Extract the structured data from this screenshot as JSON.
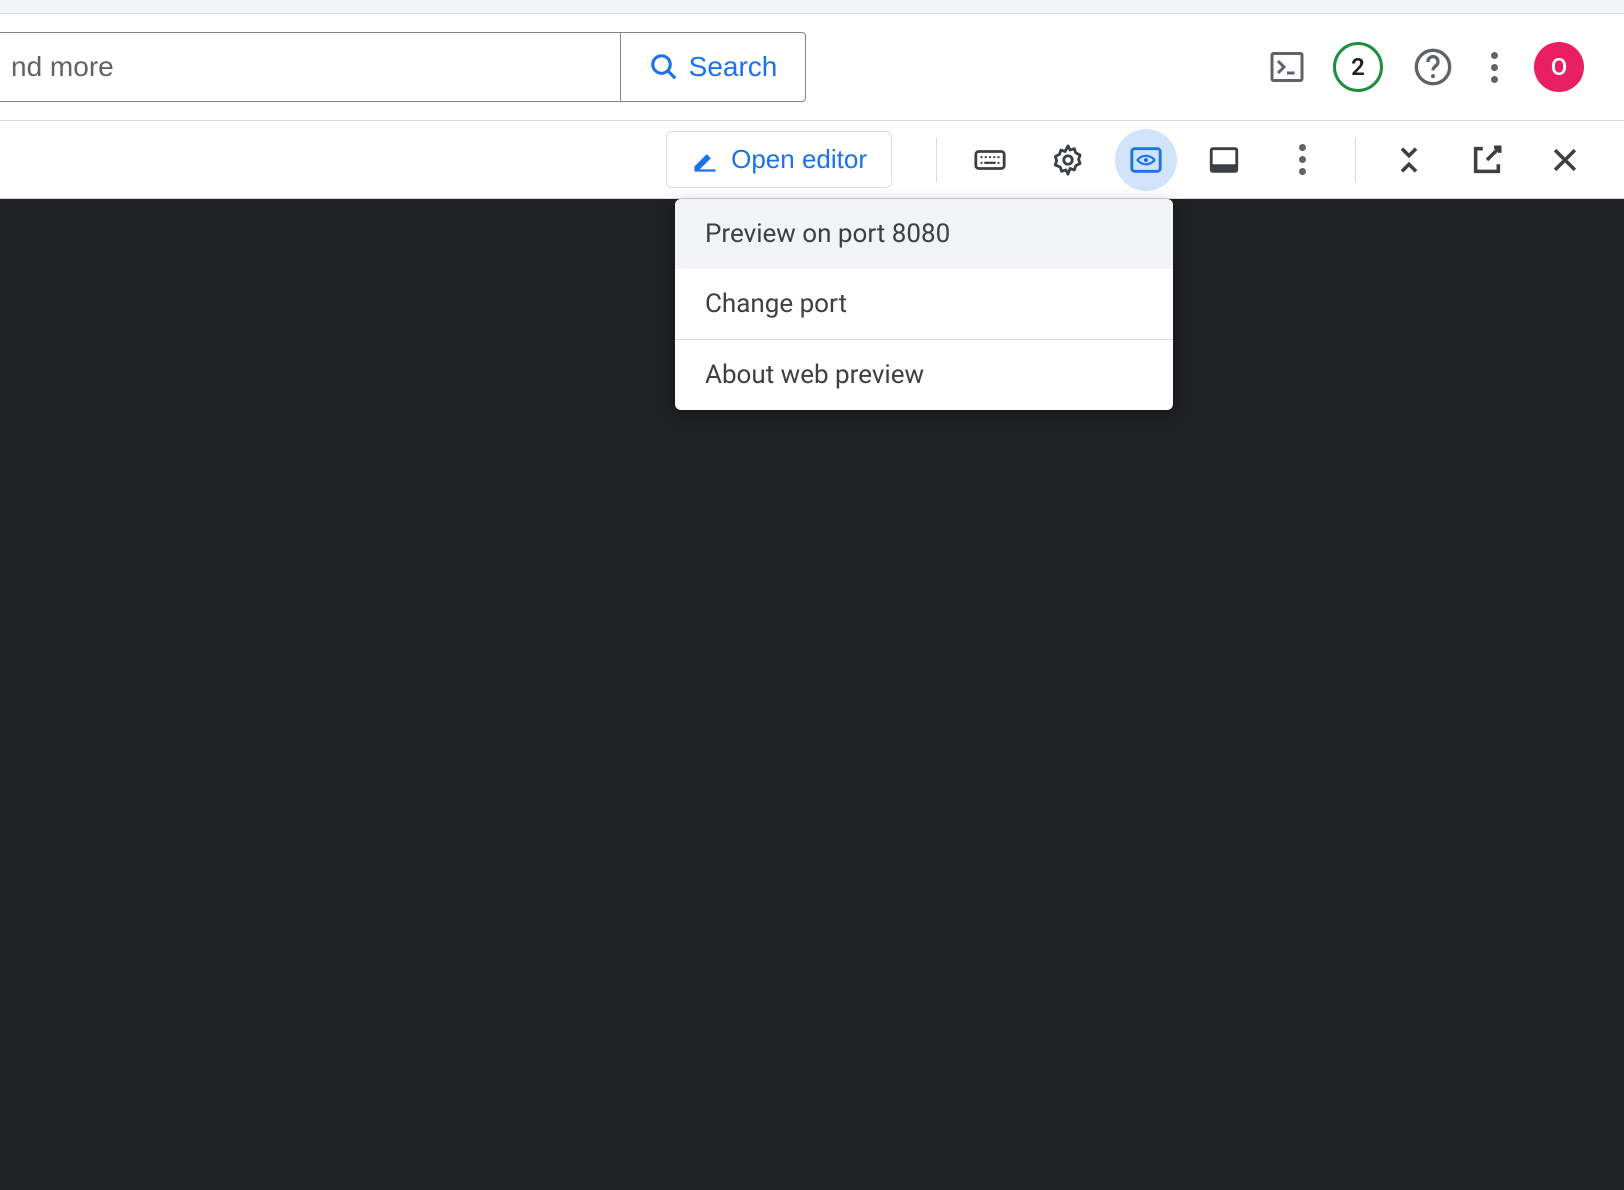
{
  "header": {
    "search_placeholder": "nd more",
    "search_button_label": "Search",
    "free_trial_count": "2",
    "avatar_letter": "O"
  },
  "toolbar": {
    "open_editor_label": "Open editor"
  },
  "dropdown": {
    "items": [
      {
        "label": "Preview on port 8080",
        "highlighted": true
      },
      {
        "label": "Change port",
        "highlighted": false
      },
      {
        "label": "About web preview",
        "highlighted": false,
        "separated": true
      }
    ]
  }
}
